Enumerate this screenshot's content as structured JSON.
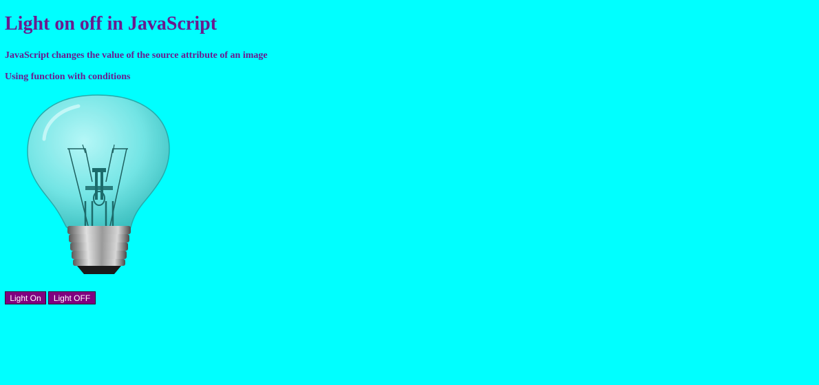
{
  "page": {
    "title": "Light on off in JavaScript",
    "subtitle_1": "JavaScript changes the value of the source attribute of an image",
    "subtitle_2": "Using function with conditions",
    "background_color": "#00ffff",
    "text_color": "#6a1b8f"
  },
  "image": {
    "icon": "lightbulb-off-icon"
  },
  "buttons": {
    "light_on_label": "Light On",
    "light_off_label": "Light OFF",
    "button_color": "#800080"
  }
}
